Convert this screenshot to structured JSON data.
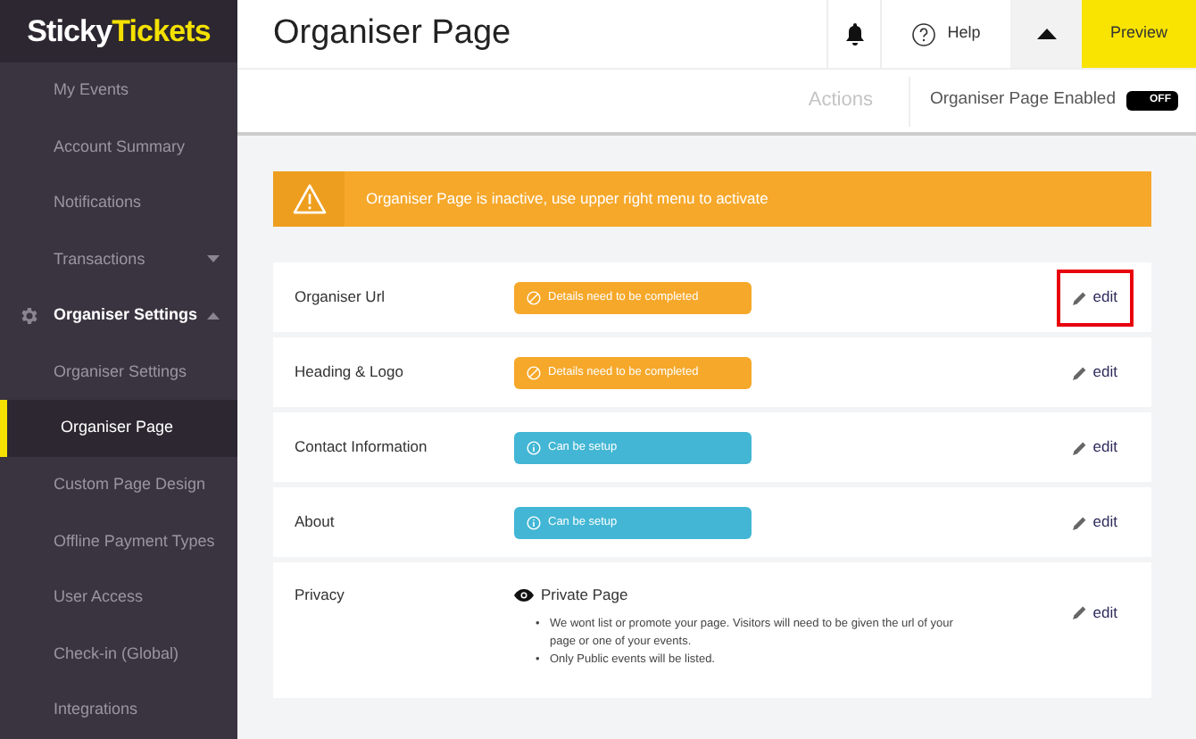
{
  "logo": {
    "part_1": "Sticky",
    "part_2": "Tickets"
  },
  "sidebar": {
    "items": [
      {
        "label": "My Events",
        "selected": false
      },
      {
        "label": "Account Summary",
        "selected": false
      },
      {
        "label": "Notifications",
        "selected": false
      },
      {
        "label": "Transactions",
        "selected": false,
        "expanded": false
      },
      {
        "label": "Organiser Settings",
        "selected": false,
        "expanded": true,
        "kind": "group",
        "children": [
          {
            "label": "Organiser Settings",
            "selected": false
          },
          {
            "label": "Organiser Page",
            "selected": true
          },
          {
            "label": "Custom Page Design",
            "selected": false
          },
          {
            "label": "Offline Payment Types",
            "selected": false
          },
          {
            "label": "User Access",
            "selected": false
          },
          {
            "label": "Check-in (Global)",
            "selected": false
          },
          {
            "label": "Integrations",
            "selected": false
          }
        ]
      }
    ]
  },
  "header": {
    "title": "Organiser Page",
    "help": "Help",
    "preview": "Preview",
    "menu_open": true
  },
  "actions_bar": {
    "actions": "Actions",
    "toggle_label": "Organiser Page Enabled",
    "toggle_text": "OFF",
    "on": false
  },
  "alert": {
    "text": "Organiser Page is inactive, use upper right menu to activate"
  },
  "rows": [
    {
      "label": "Organiser Url",
      "kind": "warning",
      "status": "Details need to be completed",
      "edit": "edit",
      "highlighted": true
    },
    {
      "label": "Heading & Logo",
      "kind": "warning",
      "status": "Details need to be completed",
      "edit": "edit",
      "highlighted": false
    },
    {
      "label": "Contact Information",
      "kind": "info",
      "status": "Can be setup",
      "edit": "edit",
      "highlighted": false
    },
    {
      "label": "About",
      "kind": "info",
      "status": "Can be setup",
      "edit": "edit",
      "highlighted": false
    },
    {
      "label": "Privacy",
      "kind": "privacy",
      "status": "Private Page",
      "edit": "edit",
      "highlighted": false,
      "notes": [
        {
          "bullet": "•",
          "text": "We wont list or promote your page. Visitors will need to be given the url of your page or one of your events."
        },
        {
          "bullet": "•",
          "text": "Only Public events will be listed."
        }
      ]
    }
  ]
}
